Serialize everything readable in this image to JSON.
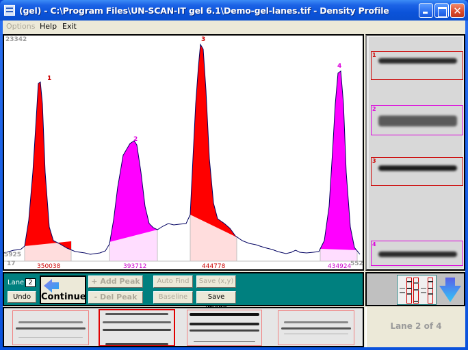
{
  "window": {
    "title": "(gel) - C:\\Program Files\\UN-SCAN-IT gel 6.1\\Demo-gel-lanes.tif - Density Profile",
    "controls": {
      "minimize": "minimize",
      "maximize": "maximize",
      "close": "✕"
    }
  },
  "menu": {
    "items": [
      {
        "label": "Options",
        "disabled": true
      },
      {
        "label": "Help",
        "disabled": false
      },
      {
        "label": "Exit",
        "disabled": false
      }
    ]
  },
  "plot": {
    "y_max_label": "23342",
    "y_min_label": "5925",
    "x_min_label": "17",
    "x_max_label": "552",
    "peaks": [
      {
        "label": "1",
        "area": "350038",
        "color": "#ff0000",
        "label_color": "#cc0000",
        "area_color": "#cc0000"
      },
      {
        "label": "2",
        "area": "393712",
        "color": "#ff00ff",
        "label_color": "#dd00dd",
        "area_color": "#cc00cc"
      },
      {
        "label": "3",
        "area": "444778",
        "color": "#ff0000",
        "label_color": "#cc0000",
        "area_color": "#cc0000"
      },
      {
        "label": "4",
        "area": "434924",
        "color": "#ff00ff",
        "label_color": "#dd00dd",
        "area_color": "#cc00cc"
      }
    ],
    "colors": {
      "profile_line": "#000060",
      "baseline_fill_red": "#ffdddd",
      "baseline_fill_magenta": "#ffddff"
    }
  },
  "controls": {
    "lane_label": "Lane",
    "lane_value": "2",
    "undo": "Undo",
    "continue": "Continue",
    "add_peak": "+ Add Peak",
    "del_peak": "- Del Peak",
    "auto_find": "Auto Find",
    "baseline": "Baseline",
    "save_xy": "Save (x,y)",
    "save_image": "Save Image"
  },
  "band_view": {
    "bands": [
      {
        "label": "1",
        "color": "#cc0000"
      },
      {
        "label": "2",
        "color": "#dd00dd"
      },
      {
        "label": "3",
        "color": "#cc0000"
      },
      {
        "label": "4",
        "color": "#dd00dd"
      }
    ]
  },
  "lane_strip": {
    "lane_count": 4,
    "selected_lane": 2
  },
  "status": {
    "lane_text": "Lane 2 of 4"
  }
}
